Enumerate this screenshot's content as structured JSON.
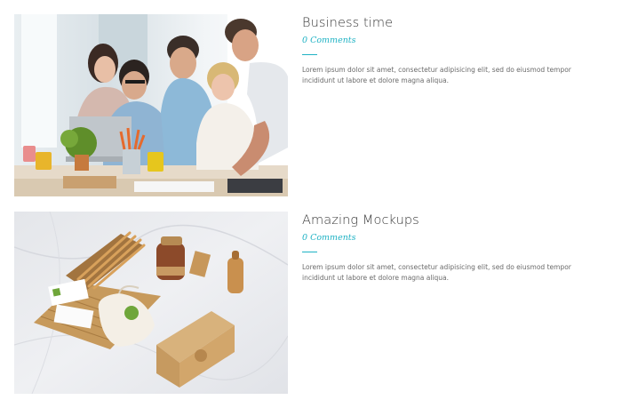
{
  "posts": [
    {
      "title": "Business time",
      "comments": "0 Comments",
      "excerpt": "Lorem ipsum dolor sit amet, consectetur adipisicing elit, sed do eiusmod tempor incididunt ut labore et dolore magna aliqua.",
      "image_subject": "team-around-laptop-photo"
    },
    {
      "title": "Amazing Mockups",
      "comments": "0 Comments",
      "excerpt": "Lorem ipsum dolor sit amet, consectetur adipisicing elit, sed do eiusmod tempor incididunt ut labore et dolore magna aliqua.",
      "image_subject": "branding-mockup-photo"
    }
  ],
  "colors": {
    "accent": "#1fb2c4",
    "title": "#3a3a3a",
    "body_text": "#6b6b6b",
    "background": "#ffffff"
  }
}
